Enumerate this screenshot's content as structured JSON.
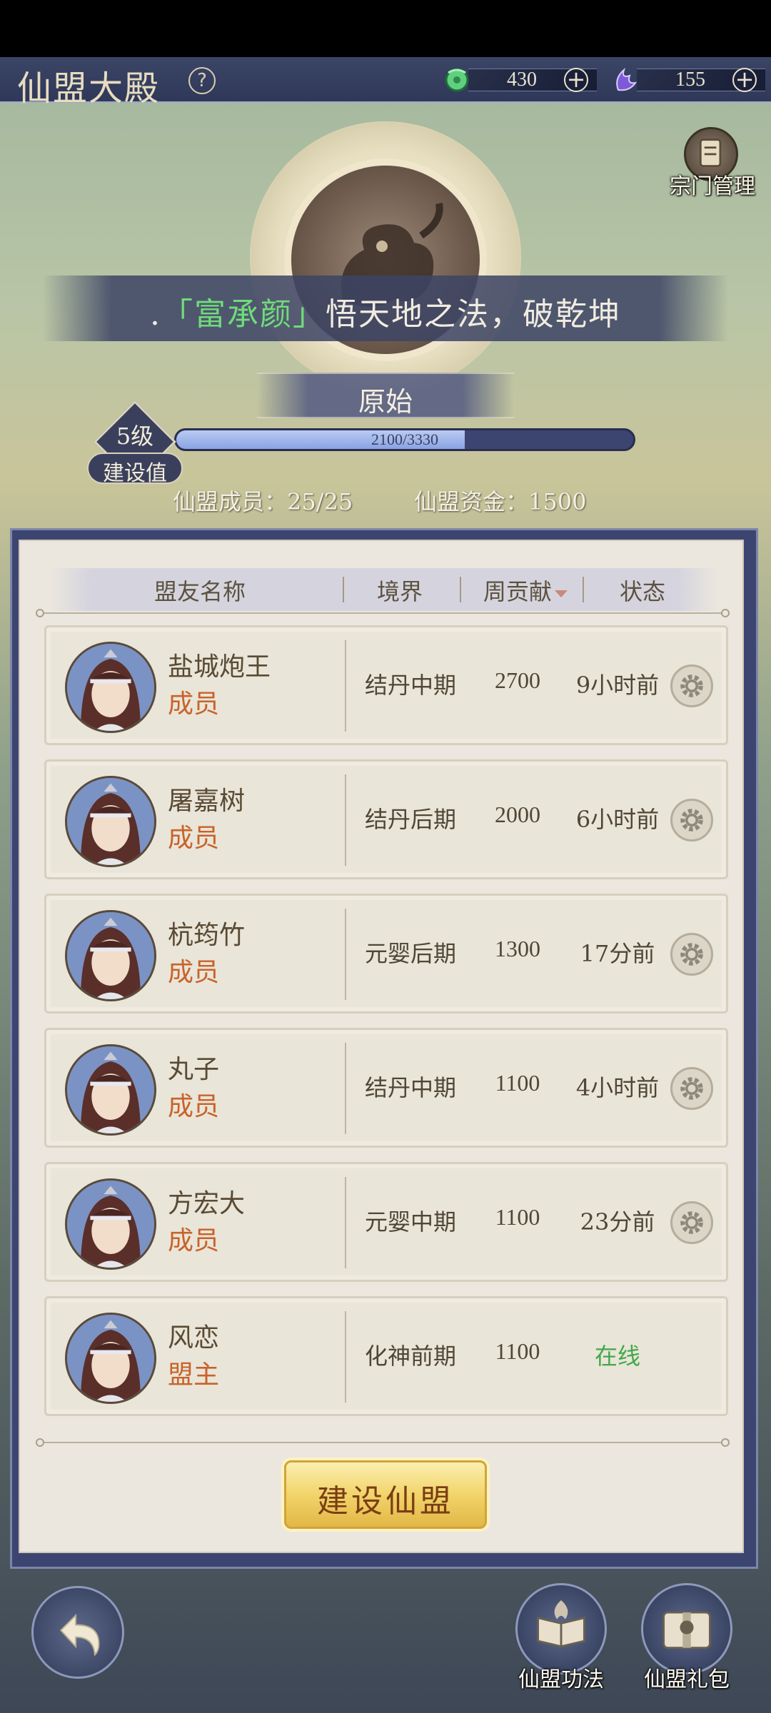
{
  "header": {
    "title": "仙盟大殿",
    "help_icon": "?",
    "resources": [
      {
        "icon": "jade-icon",
        "value": "430",
        "color": "#59d07a"
      },
      {
        "icon": "spirit-crystal-icon",
        "value": "155",
        "color": "#7d5bd6"
      }
    ]
  },
  "sect_manage_label": "宗门管理",
  "banner": {
    "name": "富承颜",
    "bracket_open": "「",
    "bracket_close": "」",
    "message": "悟天地之法，破乾坤",
    "dot": "."
  },
  "rank": "原始",
  "level": {
    "label": "5级",
    "build_label": "建设值",
    "progress_text": "2100/3330",
    "current": 2100,
    "max": 3330
  },
  "stats": {
    "members": "仙盟成员：25/25",
    "funds": "仙盟资金：1500"
  },
  "table": {
    "headers": [
      "盟友名称",
      "境界",
      "周贡献",
      "状态"
    ],
    "rows": [
      {
        "name": "盐城炮王",
        "role": "成员",
        "realm": "结丹中期",
        "contribution": "2700",
        "status": "9小时前",
        "online": false
      },
      {
        "name": "屠嘉树",
        "role": "成员",
        "realm": "结丹后期",
        "contribution": "2000",
        "status": "6小时前",
        "online": false
      },
      {
        "name": "杭筠竹",
        "role": "成员",
        "realm": "元婴后期",
        "contribution": "1300",
        "status": "17分前",
        "online": false
      },
      {
        "name": "丸子",
        "role": "成员",
        "realm": "结丹中期",
        "contribution": "1100",
        "status": "4小时前",
        "online": false
      },
      {
        "name": "方宏大",
        "role": "成员",
        "realm": "元婴中期",
        "contribution": "1100",
        "status": "23分前",
        "online": false
      },
      {
        "name": "风恋",
        "role": "盟主",
        "realm": "化神前期",
        "contribution": "1100",
        "status": "在线",
        "online": true
      }
    ]
  },
  "build_button": "建设仙盟",
  "bottom_nav": [
    {
      "label": "仙盟功法",
      "icon": "technique-book-icon"
    },
    {
      "label": "仙盟礼包",
      "icon": "gift-pack-icon"
    }
  ],
  "colors": {
    "online": "#42a84a",
    "role": "#c9622a",
    "banner_name": "#6fdc7a"
  }
}
